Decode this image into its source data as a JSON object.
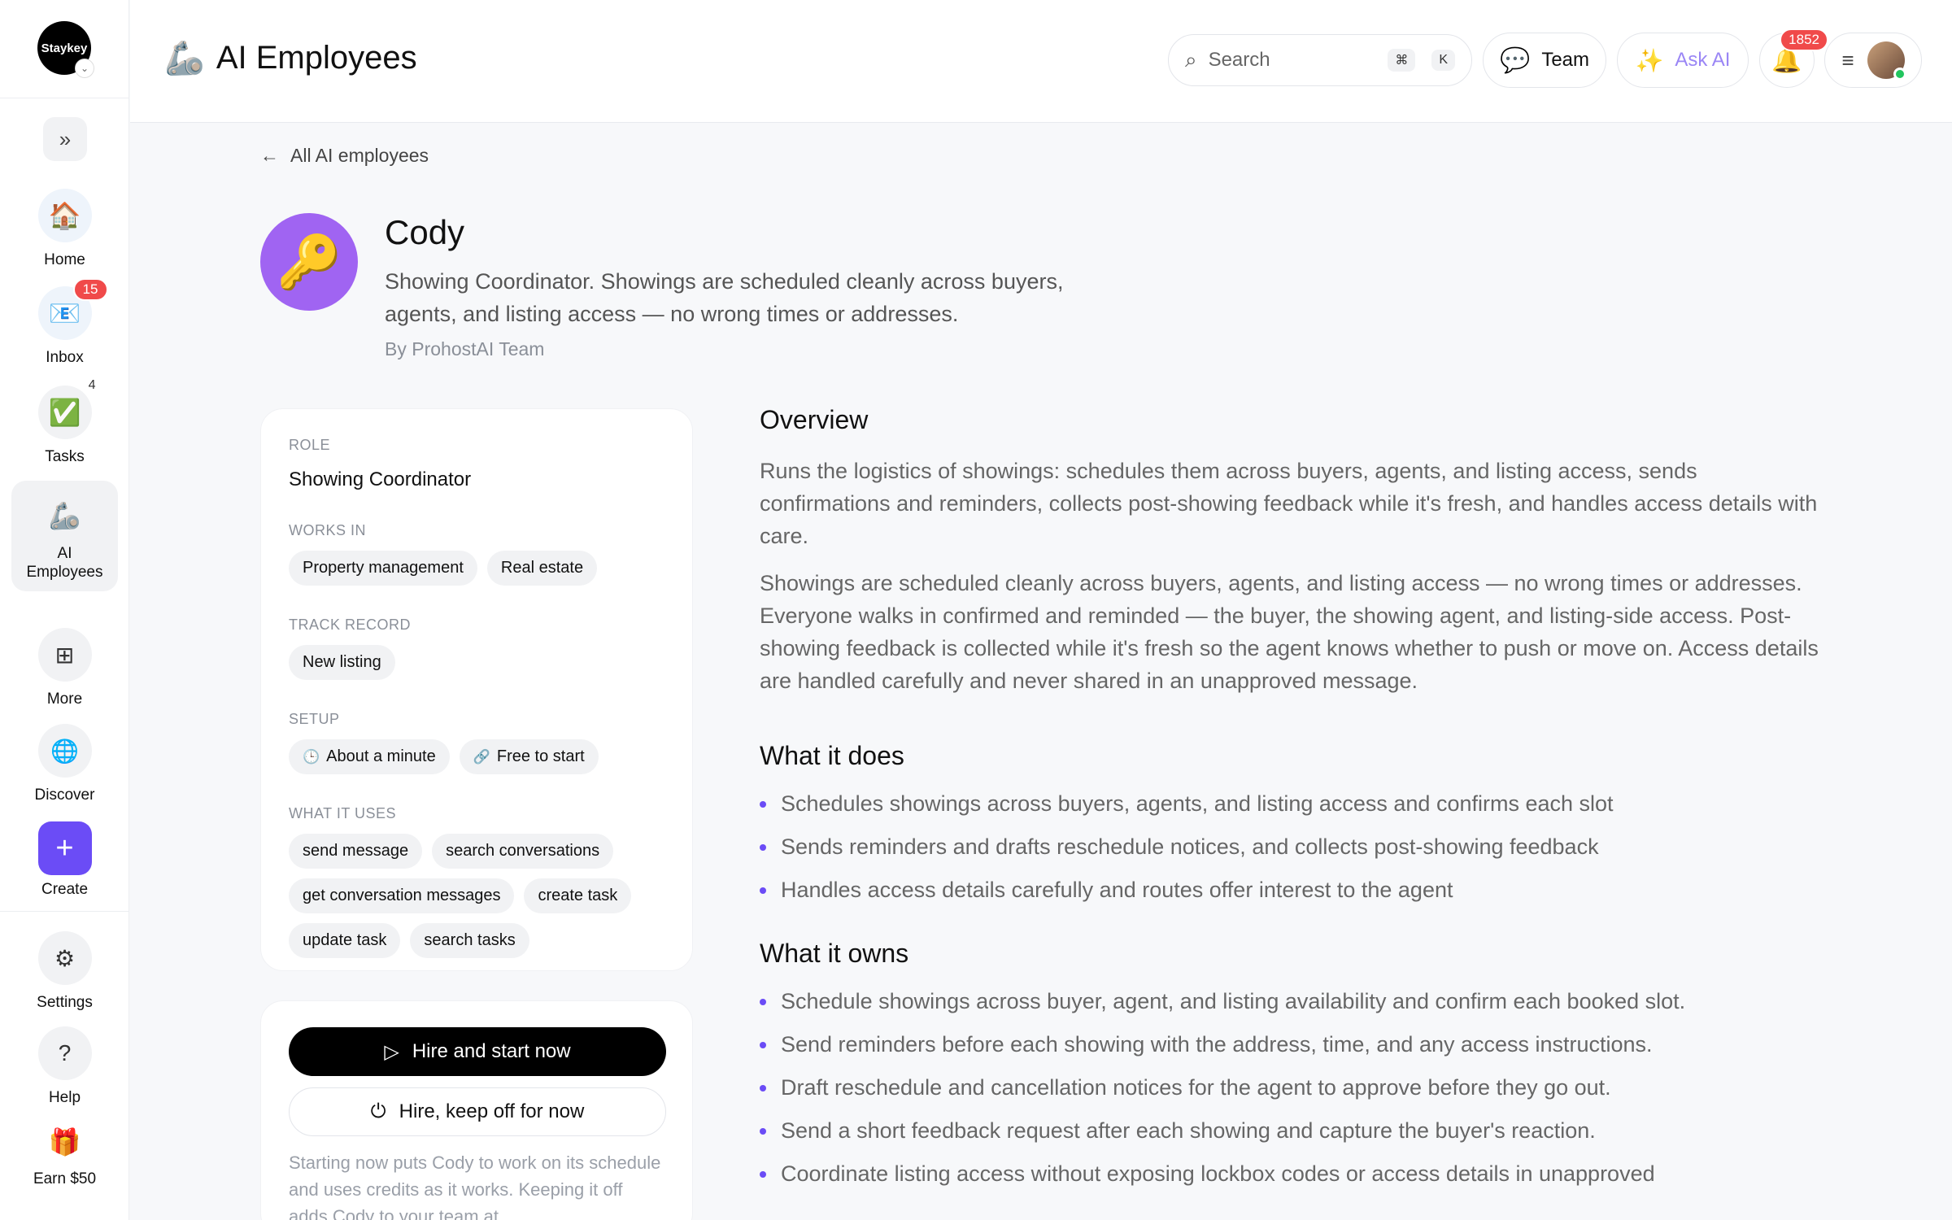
{
  "sidebar": {
    "logo_text": "Staykey",
    "items": [
      {
        "label": "Home",
        "icon": "🏠"
      },
      {
        "label": "Inbox",
        "icon": "📧",
        "badge": "15"
      },
      {
        "label": "Tasks",
        "icon": "✅",
        "badge": "4"
      },
      {
        "label": "AI Employees",
        "icon": "🦾"
      },
      {
        "label": "More",
        "icon": "⊞"
      },
      {
        "label": "Discover",
        "icon": "🌐"
      },
      {
        "label": "Create",
        "icon": "+"
      },
      {
        "label": "Settings",
        "icon": "⚙"
      },
      {
        "label": "Help",
        "icon": "?"
      },
      {
        "label": "Earn $50",
        "icon": "🎁"
      }
    ]
  },
  "header": {
    "title": "AI Employees",
    "title_icon": "🦾",
    "search_placeholder": "Search",
    "search_kbd_1": "⌘",
    "search_kbd_2": "K",
    "team_label": "Team",
    "ask_label": "Ask AI",
    "notifications_count": "1852"
  },
  "main": {
    "back_label": "All AI employees",
    "employee": {
      "avatar_icon": "🔑",
      "name": "Cody",
      "description": "Showing Coordinator. Showings are scheduled cleanly across buyers, agents, and listing access — no wrong times or addresses.",
      "by": "By ProhostAI Team"
    },
    "info": {
      "role_label": "ROLE",
      "role_value": "Showing Coordinator",
      "works_in_label": "WORKS IN",
      "works_in": [
        "Property management",
        "Real estate"
      ],
      "track_record_label": "TRACK RECORD",
      "track_record": [
        "New listing"
      ],
      "setup_label": "SETUP",
      "setup": [
        {
          "icon": "🕒",
          "label": "About a minute"
        },
        {
          "icon": "🔗",
          "label": "Free to start"
        }
      ],
      "uses_label": "WHAT IT USES",
      "uses": [
        "send message",
        "search conversations",
        "get conversation messages",
        "create task",
        "update task",
        "search tasks"
      ]
    },
    "cta": {
      "primary": "Hire and start now",
      "secondary": "Hire, keep off for now",
      "note": "Starting now puts Cody to work on its schedule and uses credits as it works. Keeping it off adds Cody to your team at"
    },
    "overview": {
      "title": "Overview",
      "paragraphs": [
        "Runs the logistics of showings: schedules them across buyers, agents, and listing access, sends confirmations and reminders, collects post-showing feedback while it's fresh, and handles access details with care.",
        "Showings are scheduled cleanly across buyers, agents, and listing access — no wrong times or addresses. Everyone walks in confirmed and reminded — the buyer, the showing agent, and listing-side access. Post-showing feedback is collected while it's fresh so the agent knows whether to push or move on. Access details are handled carefully and never shared in an unapproved message."
      ]
    },
    "does": {
      "title": "What it does",
      "items": [
        "Schedules showings across buyers, agents, and listing access and confirms each slot",
        "Sends reminders and drafts reschedule notices, and collects post-showing feedback",
        "Handles access details carefully and routes offer interest to the agent"
      ]
    },
    "owns": {
      "title": "What it owns",
      "items": [
        "Schedule showings across buyer, agent, and listing availability and confirm each booked slot.",
        "Send reminders before each showing with the address, time, and any access instructions.",
        "Draft reschedule and cancellation notices for the agent to approve before they go out.",
        "Send a short feedback request after each showing and capture the buyer's reaction.",
        "Coordinate listing access without exposing lockbox codes or access details in unapproved"
      ]
    }
  }
}
